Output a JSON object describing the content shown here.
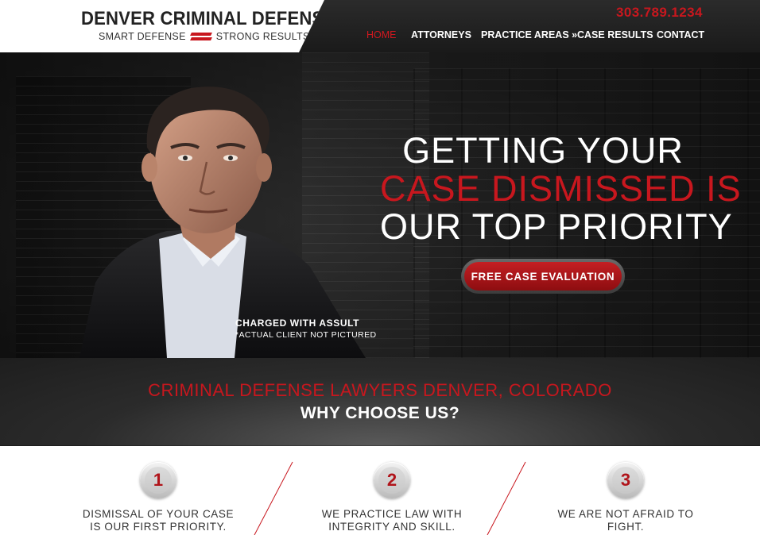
{
  "header": {
    "logo_title": "DENVER CRIMINAL DEFENSE",
    "logo_sub_left": "SMART DEFENSE",
    "logo_sub_right": "STRONG RESULTS",
    "phone": "303.789.1234",
    "nav": {
      "home": "HOME",
      "attorneys": "ATTORNEYS",
      "practice_areas": "PRACTICE AREAS »",
      "case_results": "CASE RESULTS",
      "contact": "CONTACT"
    }
  },
  "hero": {
    "headline_line1": "GETTING YOUR",
    "headline_line2": "CASE DISMISSED IS",
    "headline_line3": "OUR TOP PRIORITY",
    "cta_label": "FREE CASE EVALUATION",
    "caption_line1": "CHARGED WITH ASSULT",
    "caption_line2": "*ACTUAL CLIENT NOT PICTURED"
  },
  "banner": {
    "subtitle": "CRIMINAL DEFENSE LAWYERS DENVER, COLORADO",
    "title": "WHY CHOOSE US?"
  },
  "features": [
    {
      "number": "1",
      "line1": "DISMISSAL OF YOUR CASE",
      "line2": "IS OUR FIRST PRIORITY."
    },
    {
      "number": "2",
      "line1": "WE PRACTICE LAW WITH",
      "line2": "INTEGRITY AND SKILL."
    },
    {
      "number": "3",
      "line1": "WE ARE NOT AFRAID TO",
      "line2": "FIGHT."
    }
  ],
  "colors": {
    "accent_red": "#c8171e",
    "dark_bg": "#1f1f1f",
    "text_dark": "#333333"
  }
}
